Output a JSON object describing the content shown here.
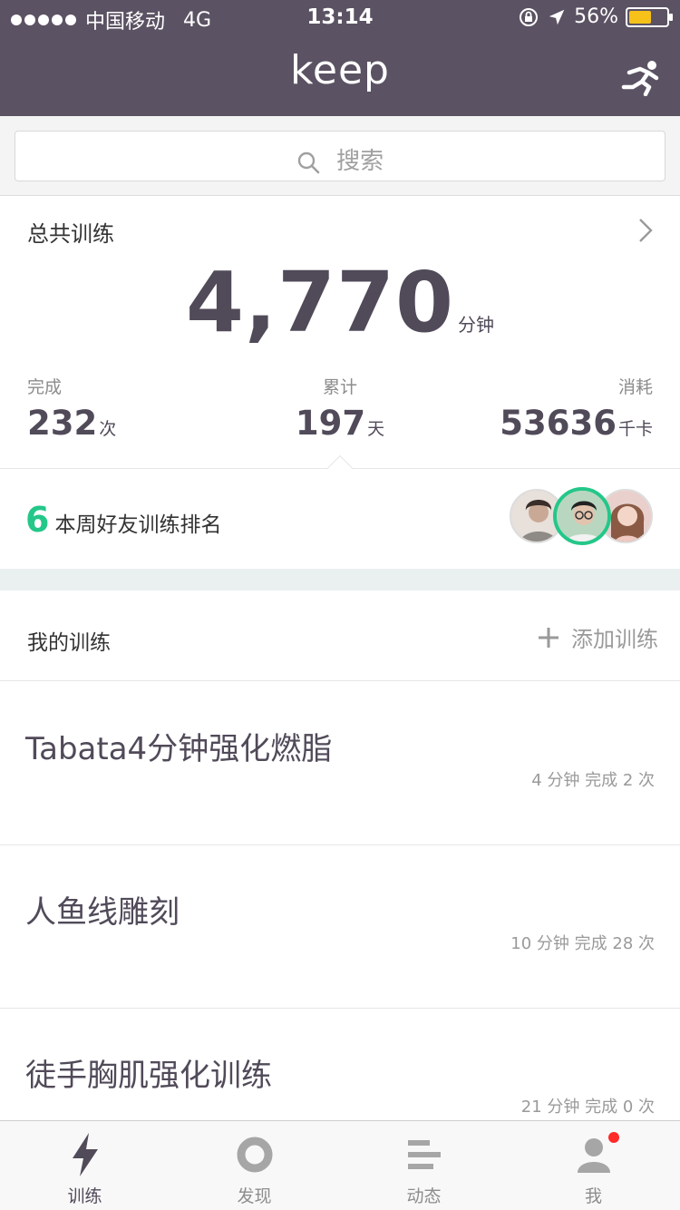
{
  "status_bar": {
    "carrier": "中国移动",
    "network": "4G",
    "time": "13:14",
    "battery": "56%"
  },
  "nav": {
    "title": "keep",
    "run_icon": "run-icon"
  },
  "search": {
    "placeholder": "搜索"
  },
  "summary": {
    "title": "总共训练",
    "total_minutes": "4,770",
    "total_unit": "分钟",
    "stats": [
      {
        "label": "完成",
        "value": "232",
        "unit": "次"
      },
      {
        "label": "累计",
        "value": "197",
        "unit": "天"
      },
      {
        "label": "消耗",
        "value": "53636",
        "unit": "千卡"
      }
    ]
  },
  "friends": {
    "rank": "6",
    "text": "本周好友训练排名"
  },
  "my_training": {
    "title": "我的训练",
    "add_label": "添加训练"
  },
  "workouts": [
    {
      "name": "Tabata4分钟强化燃脂",
      "meta": "4 分钟 完成 2 次"
    },
    {
      "name": "人鱼线雕刻",
      "meta": "10 分钟 完成 28 次"
    },
    {
      "name": "徒手胸肌强化训练",
      "meta": "21 分钟 完成 0 次"
    }
  ],
  "tabs": [
    {
      "label": "训练",
      "icon": "lightning-icon",
      "active": true
    },
    {
      "label": "发现",
      "icon": "ring-icon",
      "active": false
    },
    {
      "label": "动态",
      "icon": "feed-lines-icon",
      "active": false
    },
    {
      "label": "我",
      "icon": "person-icon",
      "active": false
    }
  ],
  "colors": {
    "header": "#5b5263",
    "accent": "#24c789",
    "text_dark": "#514a59",
    "battery": "#f6c21a",
    "badge": "#ff2a2a"
  }
}
